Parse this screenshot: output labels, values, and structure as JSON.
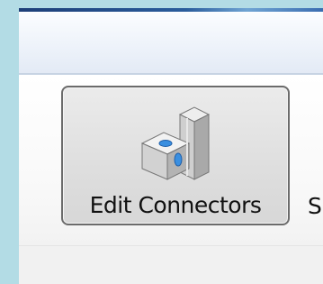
{
  "ribbon": {
    "tools": [
      {
        "label": "Edit Connectors",
        "icon": "edit-connectors-icon"
      },
      {
        "label": "S"
      }
    ]
  },
  "colors": {
    "window_frame": "#b3dce5",
    "title_edge": "#2a5d9c",
    "button_border": "#6b6b6b",
    "icon_accent": "#3a8fe0"
  }
}
